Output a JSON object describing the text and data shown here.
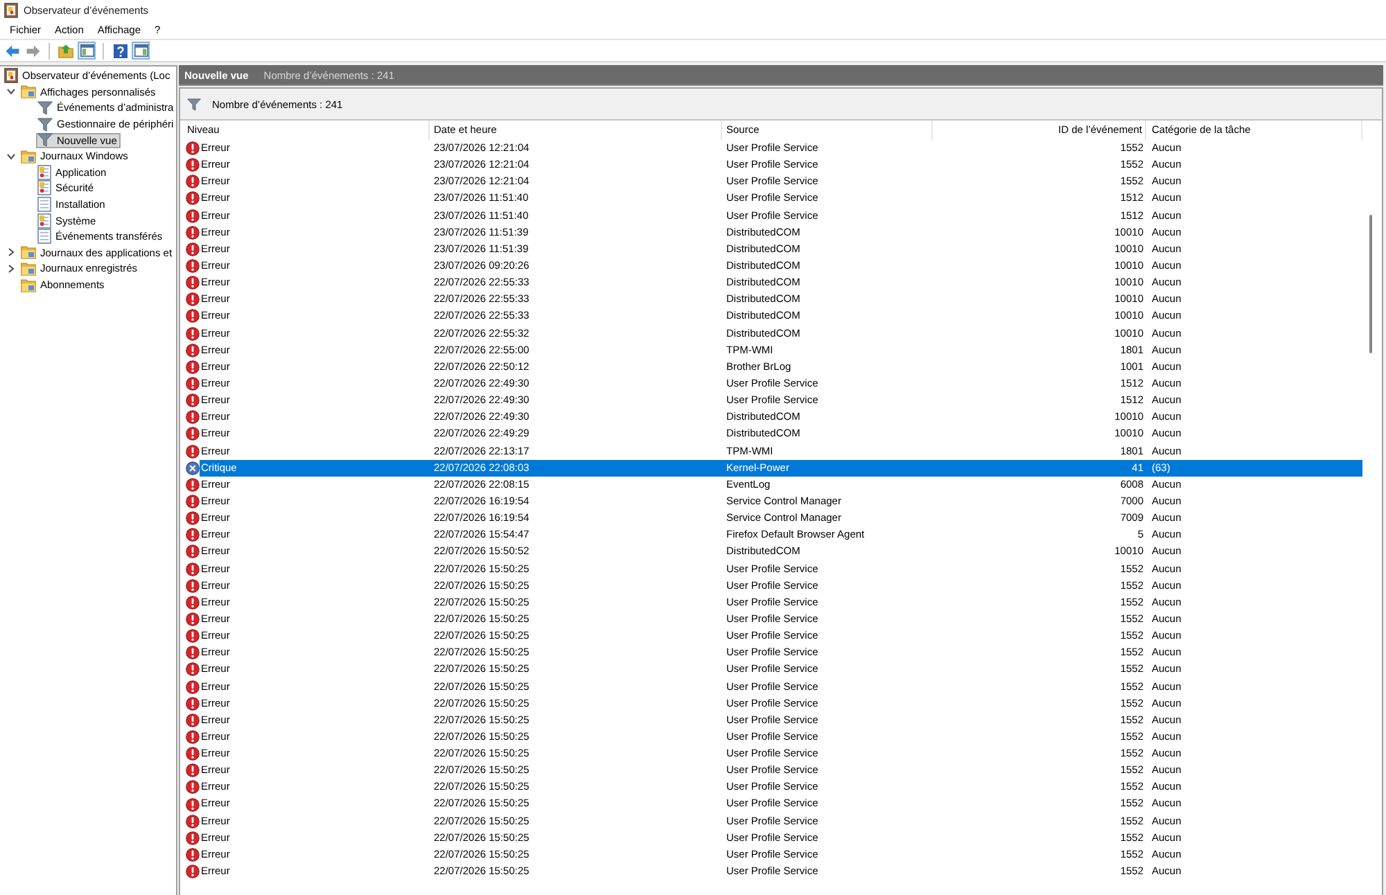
{
  "window": {
    "title": "Observateur d’événements"
  },
  "menu": [
    "Fichier",
    "Action",
    "Affichage",
    "?"
  ],
  "toolbar": {
    "back": {
      "disabled": false
    },
    "forward": {
      "disabled": true
    },
    "console_tree_toggle": {
      "pressed": true
    },
    "action_pane_toggle": {
      "pressed": true
    }
  },
  "tree": [
    {
      "label": "Observateur d’événements (Loc",
      "kind": "root",
      "selected": false,
      "children": [
        {
          "label": "Affichages personnalisés",
          "kind": "folder",
          "selected": false,
          "expanded": true,
          "children": [
            {
              "label": "Événements d’administra",
              "kind": "view",
              "selected": false
            },
            {
              "label": "Gestionnaire de périphéri",
              "kind": "view",
              "selected": false
            },
            {
              "label": "Nouvelle vue",
              "kind": "view",
              "selected": true
            }
          ]
        },
        {
          "label": "Journaux Windows",
          "kind": "folder",
          "selected": false,
          "expanded": true,
          "children": [
            {
              "label": "Application",
              "kind": "log",
              "selected": false
            },
            {
              "label": "Sécurité",
              "kind": "log",
              "selected": false
            },
            {
              "label": "Installation",
              "kind": "emptylog",
              "selected": false
            },
            {
              "label": "Système",
              "kind": "log",
              "selected": false
            },
            {
              "label": "Événements transférés",
              "kind": "emptylog",
              "selected": false
            }
          ]
        },
        {
          "label": "Journaux des applications et",
          "kind": "folder",
          "selected": false,
          "expanded": false
        },
        {
          "label": "Journaux enregistrés",
          "kind": "folder",
          "selected": false,
          "expanded": false
        },
        {
          "label": "Abonnements",
          "kind": "folder",
          "selected": false
        }
      ]
    }
  ],
  "view_header": {
    "title": "Nouvelle vue",
    "count": "Nombre d’événements : 241"
  },
  "filter_bar": {
    "text": "Nombre d’événements : 241"
  },
  "table": {
    "columns": [
      "Niveau",
      "Date et heure",
      "Source",
      "ID de l’événement",
      "Catégorie de la tâche"
    ],
    "rows": [
      {
        "kind": "error",
        "severity": "Erreur",
        "date": "23/07/2026 12:21:04",
        "source": "User Profile Service",
        "event_id": "1552",
        "category": "Aucun",
        "selected": false
      },
      {
        "kind": "error",
        "severity": "Erreur",
        "date": "23/07/2026 12:21:04",
        "source": "User Profile Service",
        "event_id": "1552",
        "category": "Aucun",
        "selected": false
      },
      {
        "kind": "error",
        "severity": "Erreur",
        "date": "23/07/2026 12:21:04",
        "source": "User Profile Service",
        "event_id": "1552",
        "category": "Aucun",
        "selected": false
      },
      {
        "kind": "error",
        "severity": "Erreur",
        "date": "23/07/2026 11:51:40",
        "source": "User Profile Service",
        "event_id": "1512",
        "category": "Aucun",
        "selected": false
      },
      {
        "kind": "error",
        "severity": "Erreur",
        "date": "23/07/2026 11:51:40",
        "source": "User Profile Service",
        "event_id": "1512",
        "category": "Aucun",
        "selected": false
      },
      {
        "kind": "error",
        "severity": "Erreur",
        "date": "23/07/2026 11:51:39",
        "source": "DistributedCOM",
        "event_id": "10010",
        "category": "Aucun",
        "selected": false
      },
      {
        "kind": "error",
        "severity": "Erreur",
        "date": "23/07/2026 11:51:39",
        "source": "DistributedCOM",
        "event_id": "10010",
        "category": "Aucun",
        "selected": false
      },
      {
        "kind": "error",
        "severity": "Erreur",
        "date": "23/07/2026 09:20:26",
        "source": "DistributedCOM",
        "event_id": "10010",
        "category": "Aucun",
        "selected": false
      },
      {
        "kind": "error",
        "severity": "Erreur",
        "date": "22/07/2026 22:55:33",
        "source": "DistributedCOM",
        "event_id": "10010",
        "category": "Aucun",
        "selected": false
      },
      {
        "kind": "error",
        "severity": "Erreur",
        "date": "22/07/2026 22:55:33",
        "source": "DistributedCOM",
        "event_id": "10010",
        "category": "Aucun",
        "selected": false
      },
      {
        "kind": "error",
        "severity": "Erreur",
        "date": "22/07/2026 22:55:33",
        "source": "DistributedCOM",
        "event_id": "10010",
        "category": "Aucun",
        "selected": false
      },
      {
        "kind": "error",
        "severity": "Erreur",
        "date": "22/07/2026 22:55:32",
        "source": "DistributedCOM",
        "event_id": "10010",
        "category": "Aucun",
        "selected": false
      },
      {
        "kind": "error",
        "severity": "Erreur",
        "date": "22/07/2026 22:55:00",
        "source": "TPM-WMI",
        "event_id": "1801",
        "category": "Aucun",
        "selected": false
      },
      {
        "kind": "error",
        "severity": "Erreur",
        "date": "22/07/2026 22:50:12",
        "source": "Brother BrLog",
        "event_id": "1001",
        "category": "Aucun",
        "selected": false
      },
      {
        "kind": "error",
        "severity": "Erreur",
        "date": "22/07/2026 22:49:30",
        "source": "User Profile Service",
        "event_id": "1512",
        "category": "Aucun",
        "selected": false
      },
      {
        "kind": "error",
        "severity": "Erreur",
        "date": "22/07/2026 22:49:30",
        "source": "User Profile Service",
        "event_id": "1512",
        "category": "Aucun",
        "selected": false
      },
      {
        "kind": "error",
        "severity": "Erreur",
        "date": "22/07/2026 22:49:30",
        "source": "DistributedCOM",
        "event_id": "10010",
        "category": "Aucun",
        "selected": false
      },
      {
        "kind": "error",
        "severity": "Erreur",
        "date": "22/07/2026 22:49:29",
        "source": "DistributedCOM",
        "event_id": "10010",
        "category": "Aucun",
        "selected": false
      },
      {
        "kind": "error",
        "severity": "Erreur",
        "date": "22/07/2026 22:13:17",
        "source": "TPM-WMI",
        "event_id": "1801",
        "category": "Aucun",
        "selected": false
      },
      {
        "kind": "critical",
        "severity": "Critique",
        "date": "22/07/2026 22:08:03",
        "source": "Kernel-Power",
        "event_id": "41",
        "category": "(63)",
        "selected": true
      },
      {
        "kind": "error",
        "severity": "Erreur",
        "date": "22/07/2026 22:08:15",
        "source": "EventLog",
        "event_id": "6008",
        "category": "Aucun",
        "selected": false
      },
      {
        "kind": "error",
        "severity": "Erreur",
        "date": "22/07/2026 16:19:54",
        "source": "Service Control Manager",
        "event_id": "7000",
        "category": "Aucun",
        "selected": false
      },
      {
        "kind": "error",
        "severity": "Erreur",
        "date": "22/07/2026 16:19:54",
        "source": "Service Control Manager",
        "event_id": "7009",
        "category": "Aucun",
        "selected": false
      },
      {
        "kind": "error",
        "severity": "Erreur",
        "date": "22/07/2026 15:54:47",
        "source": "Firefox Default Browser Agent",
        "event_id": "5",
        "category": "Aucun",
        "selected": false
      },
      {
        "kind": "error",
        "severity": "Erreur",
        "date": "22/07/2026 15:50:52",
        "source": "DistributedCOM",
        "event_id": "10010",
        "category": "Aucun",
        "selected": false
      },
      {
        "kind": "error",
        "severity": "Erreur",
        "date": "22/07/2026 15:50:25",
        "source": "User Profile Service",
        "event_id": "1552",
        "category": "Aucun",
        "selected": false
      },
      {
        "kind": "error",
        "severity": "Erreur",
        "date": "22/07/2026 15:50:25",
        "source": "User Profile Service",
        "event_id": "1552",
        "category": "Aucun",
        "selected": false
      },
      {
        "kind": "error",
        "severity": "Erreur",
        "date": "22/07/2026 15:50:25",
        "source": "User Profile Service",
        "event_id": "1552",
        "category": "Aucun",
        "selected": false
      },
      {
        "kind": "error",
        "severity": "Erreur",
        "date": "22/07/2026 15:50:25",
        "source": "User Profile Service",
        "event_id": "1552",
        "category": "Aucun",
        "selected": false
      },
      {
        "kind": "error",
        "severity": "Erreur",
        "date": "22/07/2026 15:50:25",
        "source": "User Profile Service",
        "event_id": "1552",
        "category": "Aucun",
        "selected": false
      },
      {
        "kind": "error",
        "severity": "Erreur",
        "date": "22/07/2026 15:50:25",
        "source": "User Profile Service",
        "event_id": "1552",
        "category": "Aucun",
        "selected": false
      },
      {
        "kind": "error",
        "severity": "Erreur",
        "date": "22/07/2026 15:50:25",
        "source": "User Profile Service",
        "event_id": "1552",
        "category": "Aucun",
        "selected": false
      },
      {
        "kind": "error",
        "severity": "Erreur",
        "date": "22/07/2026 15:50:25",
        "source": "User Profile Service",
        "event_id": "1552",
        "category": "Aucun",
        "selected": false
      },
      {
        "kind": "error",
        "severity": "Erreur",
        "date": "22/07/2026 15:50:25",
        "source": "User Profile Service",
        "event_id": "1552",
        "category": "Aucun",
        "selected": false
      },
      {
        "kind": "error",
        "severity": "Erreur",
        "date": "22/07/2026 15:50:25",
        "source": "User Profile Service",
        "event_id": "1552",
        "category": "Aucun",
        "selected": false
      },
      {
        "kind": "error",
        "severity": "Erreur",
        "date": "22/07/2026 15:50:25",
        "source": "User Profile Service",
        "event_id": "1552",
        "category": "Aucun",
        "selected": false
      },
      {
        "kind": "error",
        "severity": "Erreur",
        "date": "22/07/2026 15:50:25",
        "source": "User Profile Service",
        "event_id": "1552",
        "category": "Aucun",
        "selected": false
      },
      {
        "kind": "error",
        "severity": "Erreur",
        "date": "22/07/2026 15:50:25",
        "source": "User Profile Service",
        "event_id": "1552",
        "category": "Aucun",
        "selected": false
      },
      {
        "kind": "error",
        "severity": "Erreur",
        "date": "22/07/2026 15:50:25",
        "source": "User Profile Service",
        "event_id": "1552",
        "category": "Aucun",
        "selected": false
      },
      {
        "kind": "error",
        "severity": "Erreur",
        "date": "22/07/2026 15:50:25",
        "source": "User Profile Service",
        "event_id": "1552",
        "category": "Aucun",
        "selected": false
      },
      {
        "kind": "error",
        "severity": "Erreur",
        "date": "22/07/2026 15:50:25",
        "source": "User Profile Service",
        "event_id": "1552",
        "category": "Aucun",
        "selected": false
      },
      {
        "kind": "error",
        "severity": "Erreur",
        "date": "22/07/2026 15:50:25",
        "source": "User Profile Service",
        "event_id": "1552",
        "category": "Aucun",
        "selected": false
      },
      {
        "kind": "error",
        "severity": "Erreur",
        "date": "22/07/2026 15:50:25",
        "source": "User Profile Service",
        "event_id": "1552",
        "category": "Aucun",
        "selected": false
      },
      {
        "kind": "error",
        "severity": "Erreur",
        "date": "22/07/2026 15:50:25",
        "source": "User Profile Service",
        "event_id": "1552",
        "category": "Aucun",
        "selected": false
      }
    ]
  }
}
